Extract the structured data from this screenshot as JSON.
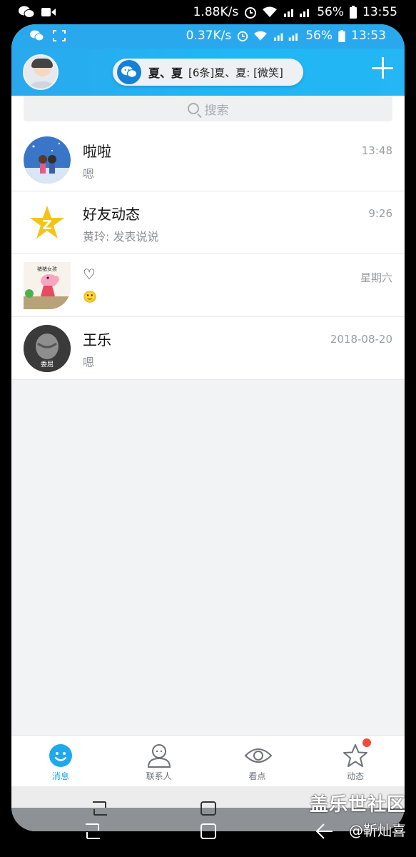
{
  "outer_status": {
    "speed": "1.88K/s",
    "battery": "56%",
    "time": "13:55"
  },
  "inner_status": {
    "speed": "0.37K/s",
    "battery": "56%",
    "time": "13:53"
  },
  "header": {
    "notify_name": "夏、夏",
    "notify_msg": "[6条]夏、夏: [微笑]"
  },
  "search": {
    "placeholder": "搜索"
  },
  "conversations": [
    {
      "title": "啦啦",
      "subtitle": "嗯",
      "time": "13:48"
    },
    {
      "title": "好友动态",
      "subtitle": "黄玲: 发表说说",
      "time": "9:26"
    },
    {
      "title": "♡",
      "subtitle": "🙂",
      "time": "星期六",
      "avatar_caption": "猪猪女孩"
    },
    {
      "title": "王乐",
      "subtitle": "嗯",
      "time": "2018-08-20",
      "avatar_caption": "委屈"
    }
  ],
  "bottom_nav": [
    {
      "label": "消息",
      "icon": "smile-bubble-icon",
      "active": true
    },
    {
      "label": "联系人",
      "icon": "person-icon",
      "active": false
    },
    {
      "label": "看点",
      "icon": "eye-icon",
      "active": false
    },
    {
      "label": "动态",
      "icon": "star-icon",
      "active": false,
      "badge": true
    }
  ],
  "watermark": {
    "line1": "盖乐世社区",
    "line2": "@靳灿喜"
  },
  "colors": {
    "accent": "#1fa8ee",
    "badge": "#f04b3a",
    "header": "#2aa8ee"
  }
}
